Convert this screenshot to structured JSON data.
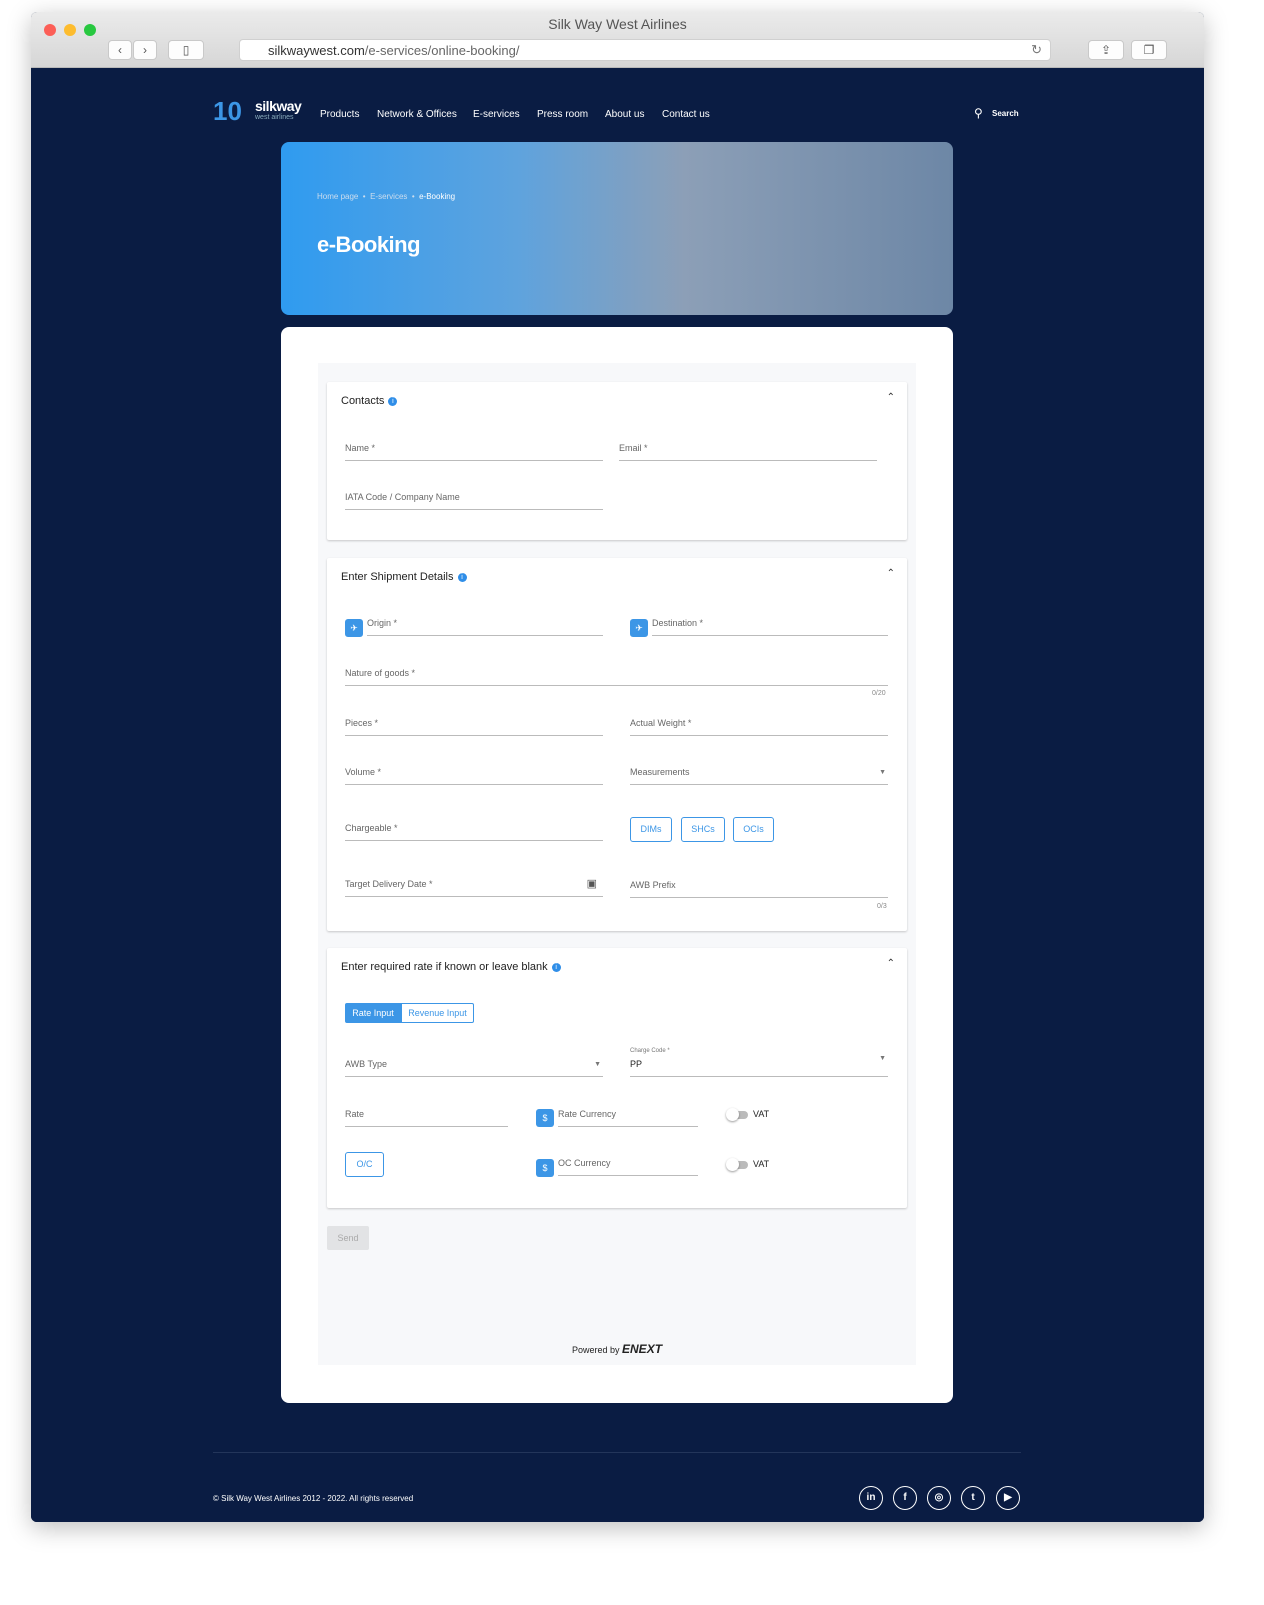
{
  "browser": {
    "title": "Silk Way West Airlines",
    "url_domain": "silkwaywest.com",
    "url_path": "/e-services/online-booking/"
  },
  "header": {
    "logo_text": "silkway",
    "logo_sub": "west airlines",
    "logo_years": "10",
    "nav": [
      "Products",
      "Network & Offices",
      "E-services",
      "Press room",
      "About us",
      "Contact us"
    ],
    "search": "Search"
  },
  "hero": {
    "breadcrumb": [
      "Home page",
      "E-services",
      "e-Booking"
    ],
    "title": "e-Booking"
  },
  "contacts": {
    "title": "Contacts",
    "name": "Name *",
    "email": "Email *",
    "iata": "IATA Code / Company Name"
  },
  "shipment": {
    "title": "Enter Shipment Details",
    "origin": "Origin *",
    "destination": "Destination *",
    "nature": "Nature of goods *",
    "nature_count": "0/20",
    "pieces": "Pieces *",
    "weight": "Actual Weight *",
    "volume": "Volume *",
    "measurements": "Measurements",
    "chargeable": "Chargeable *",
    "dims": "DIMs",
    "shcs": "SHCs",
    "ocis": "OCIs",
    "delivery": "Target Delivery Date *",
    "awb_prefix": "AWB Prefix",
    "awb_count": "0/3"
  },
  "rate": {
    "title": "Enter required rate if known or leave blank",
    "tab_rate": "Rate Input",
    "tab_revenue": "Revenue Input",
    "awb_type": "AWB Type",
    "charge_code_label": "Charge Code *",
    "charge_code": "PP",
    "rate": "Rate",
    "rate_currency": "Rate Currency",
    "vat": "VAT",
    "oc": "O/C",
    "oc_currency": "OC Currency"
  },
  "send": "Send",
  "powered_by": "Powered by",
  "powered_brand": "ENEXT",
  "footer": {
    "copyright": "© Silk Way West Airlines 2012 - 2022. All rights reserved",
    "social": [
      "in",
      "f",
      "◎",
      "t",
      "▶"
    ]
  },
  "colors": {
    "navy": "#0a1c43",
    "accent": "#3c96e6"
  }
}
